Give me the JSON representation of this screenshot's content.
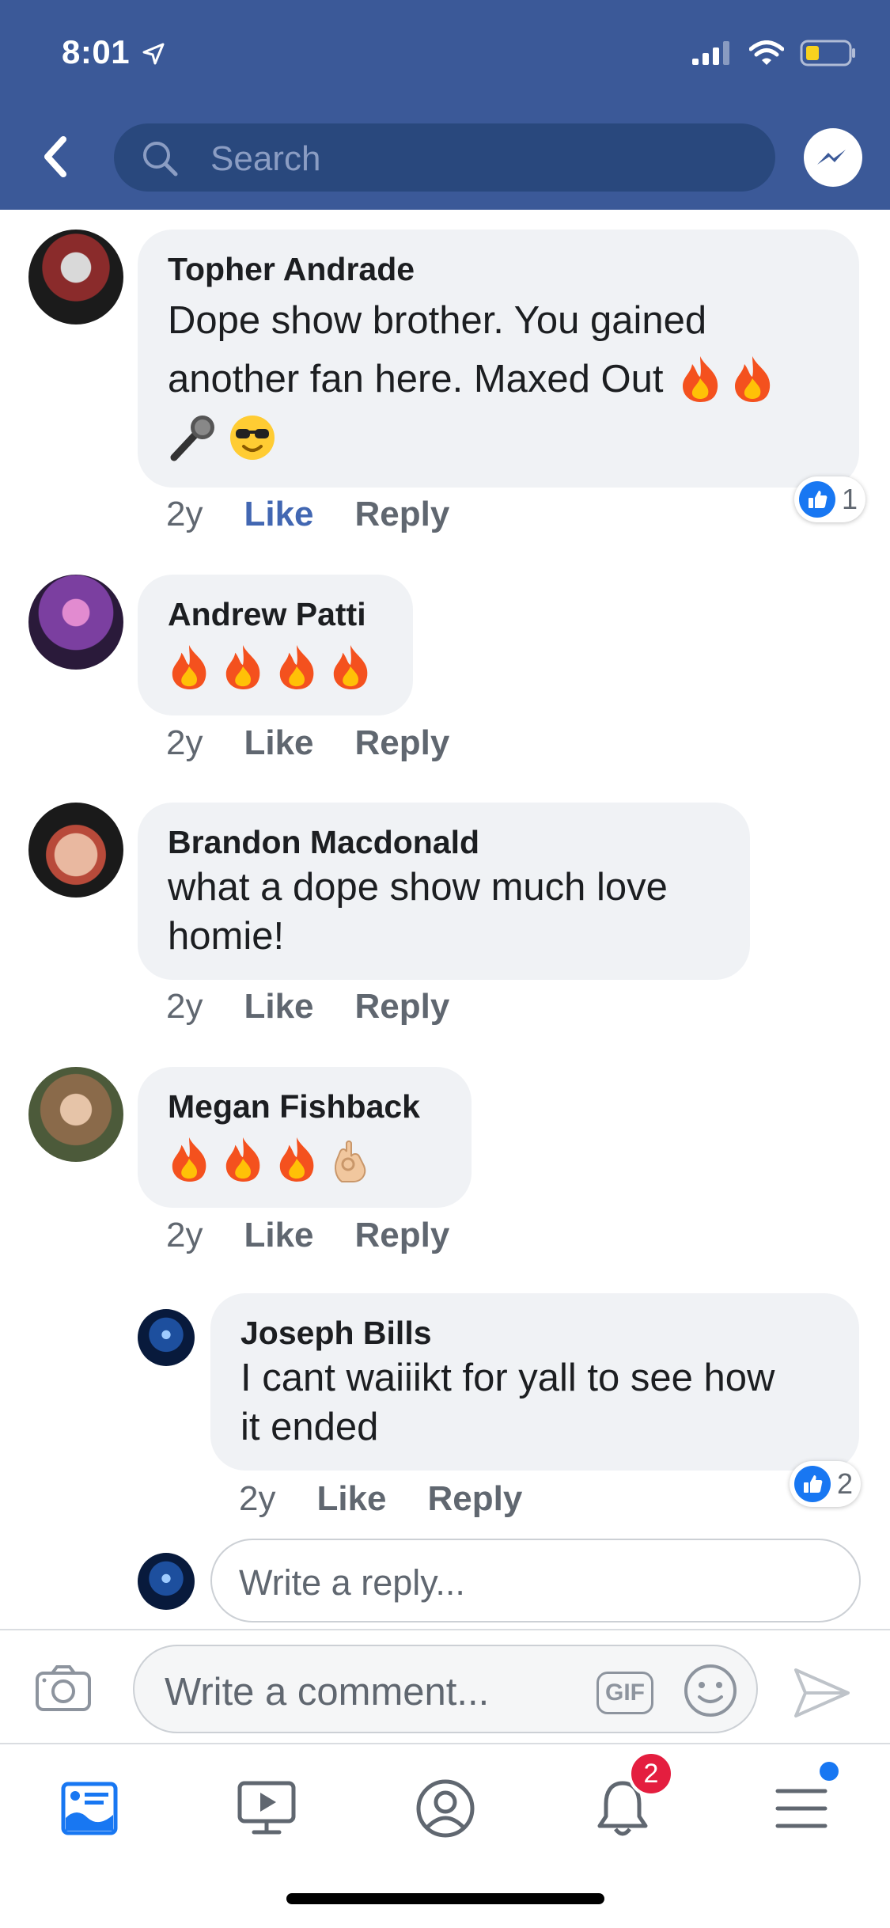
{
  "status_bar": {
    "time": "8:01"
  },
  "header": {
    "search_placeholder": "Search"
  },
  "comments": [
    {
      "author": "Topher Andrade",
      "text_line1": "Dope show brother. You gained",
      "text_line2": "another fan here. Maxed Out",
      "age": "2y",
      "like_label": "Like",
      "reply_label": "Reply",
      "liked": true,
      "reaction_count": "1",
      "emojis_inline": [
        "fire-emoji",
        "fire-emoji"
      ],
      "emojis_line3": [
        "microphone-emoji",
        "sunglasses-emoji"
      ]
    },
    {
      "author": "Andrew Patti",
      "age": "2y",
      "like_label": "Like",
      "reply_label": "Reply",
      "emojis": [
        "fire-emoji",
        "fire-emoji",
        "fire-emoji",
        "fire-emoji"
      ]
    },
    {
      "author": "Brandon Macdonald",
      "text_line1": "what a dope show much love",
      "text_line2": "homie!",
      "age": "2y",
      "like_label": "Like",
      "reply_label": "Reply"
    },
    {
      "author": "Megan Fishback",
      "age": "2y",
      "like_label": "Like",
      "reply_label": "Reply",
      "emojis": [
        "fire-emoji",
        "fire-emoji",
        "fire-emoji",
        "ok-hand-emoji"
      ]
    },
    {
      "author": "Joseph Bills",
      "text_line1": "I cant waiiikt for yall to see how",
      "text_line2": "it ended",
      "age": "2y",
      "like_label": "Like",
      "reply_label": "Reply",
      "reaction_count": "2"
    }
  ],
  "reply_input": {
    "placeholder": "Write a reply..."
  },
  "composer": {
    "placeholder": "Write a comment...",
    "gif_label": "GIF"
  },
  "tabbar": {
    "items": [
      "news-feed-icon",
      "watch-icon",
      "profile-icon",
      "notifications-icon",
      "menu-icon"
    ],
    "notification_count": "2"
  },
  "colors": {
    "header": "#3b5998",
    "like_blue": "#4267b2",
    "bubble": "#f0f2f5",
    "badge_red": "#e41e3f"
  }
}
